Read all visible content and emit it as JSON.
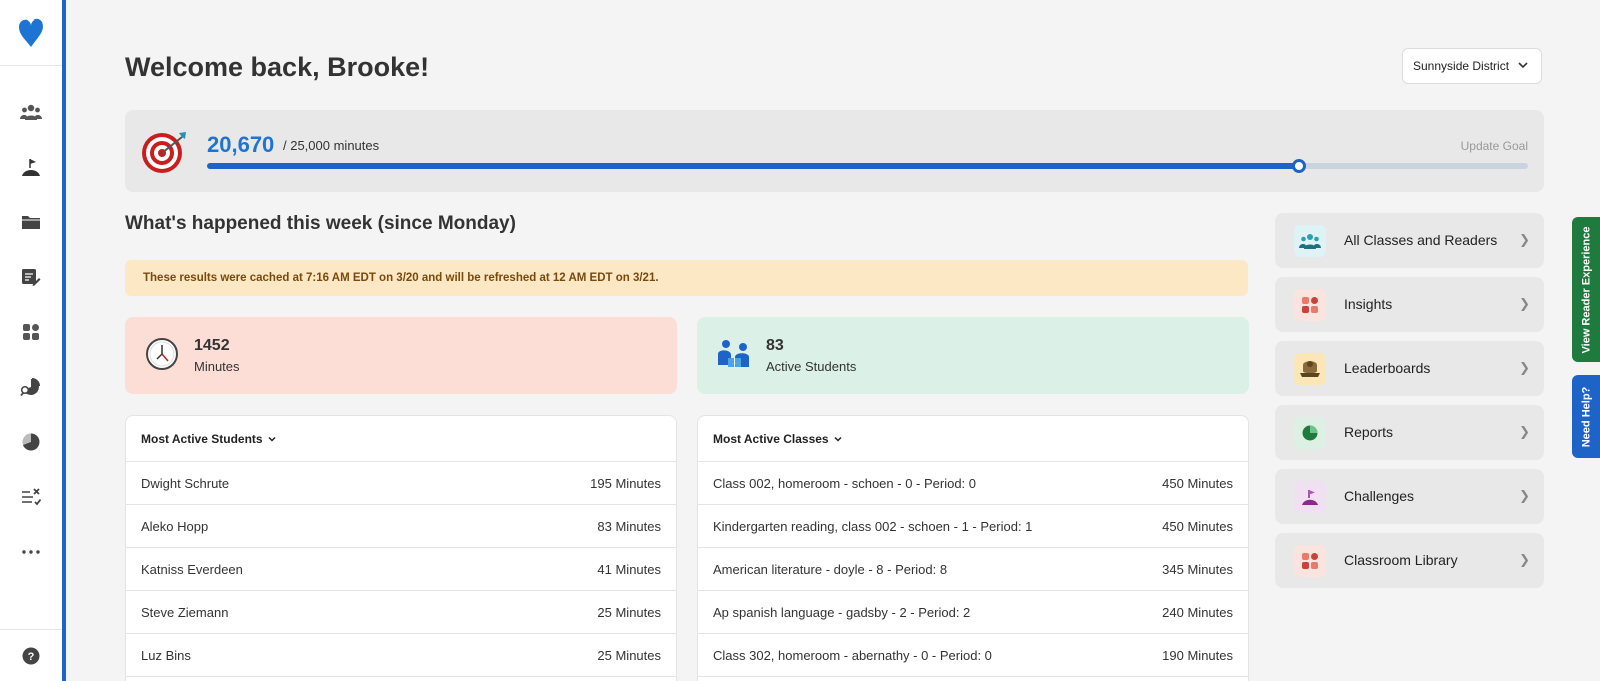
{
  "sidebar": {
    "logo": "heart-logo",
    "items": [
      {
        "name": "classes",
        "icon": "people-icon"
      },
      {
        "name": "challenges",
        "icon": "flag-icon"
      },
      {
        "name": "library",
        "icon": "folder-icon"
      },
      {
        "name": "assignments",
        "icon": "list-edit-icon"
      },
      {
        "name": "insights",
        "icon": "grid-icon"
      },
      {
        "name": "analytics",
        "icon": "pie-search-icon"
      },
      {
        "name": "reports",
        "icon": "pie-icon"
      },
      {
        "name": "tasks",
        "icon": "checklist-icon"
      },
      {
        "name": "more",
        "icon": "more-icon"
      }
    ],
    "help_icon": "help-icon"
  },
  "header": {
    "title": "Welcome back, Brooke!",
    "district": "Sunnyside District"
  },
  "goal": {
    "value": "20,670",
    "total_text": "/ 25,000 minutes",
    "update_label": "Update Goal",
    "progress": 0.8268
  },
  "week": {
    "title": "What's happened this week (since Monday)",
    "cache_note": "These results were cached at 7:16 AM EDT on 3/20 and will be refreshed at 12 AM EDT on 3/21."
  },
  "stats": {
    "minutes": {
      "value": "1452",
      "label": "Minutes"
    },
    "students": {
      "value": "83",
      "label": "Active Students"
    }
  },
  "most_active_students": {
    "label": "Most Active Students",
    "rows": [
      {
        "name": "Dwight Schrute",
        "minutes": "195 Minutes"
      },
      {
        "name": "Aleko Hopp",
        "minutes": "83 Minutes"
      },
      {
        "name": "Katniss Everdeen",
        "minutes": "41 Minutes"
      },
      {
        "name": "Steve Ziemann",
        "minutes": "25 Minutes"
      },
      {
        "name": "Luz Bins",
        "minutes": "25 Minutes"
      }
    ]
  },
  "most_active_classes": {
    "label": "Most Active Classes",
    "rows": [
      {
        "name": "Class 002, homeroom - schoen - 0 - Period: 0",
        "minutes": "450 Minutes"
      },
      {
        "name": "Kindergarten reading, class 002 - schoen - 1 - Period: 1",
        "minutes": "450 Minutes"
      },
      {
        "name": "American literature - doyle - 8 - Period: 8",
        "minutes": "345 Minutes"
      },
      {
        "name": "Ap spanish language - gadsby - 2 - Period: 2",
        "minutes": "240 Minutes"
      },
      {
        "name": "Class 302, homeroom - abernathy - 0 - Period: 0",
        "minutes": "190 Minutes"
      }
    ]
  },
  "side_nav": [
    {
      "label": "All Classes and Readers",
      "icon": "people-icon",
      "color": "#dff3f6"
    },
    {
      "label": "Insights",
      "icon": "grid-icon",
      "color": "#fbe3e0"
    },
    {
      "label": "Leaderboards",
      "icon": "trophy-icon",
      "color": "#fbe6b8"
    },
    {
      "label": "Reports",
      "icon": "pie-icon",
      "color": "#dcf1e4"
    },
    {
      "label": "Challenges",
      "icon": "flag-icon",
      "color": "#f1e0f2"
    },
    {
      "label": "Classroom Library",
      "icon": "grid-icon",
      "color": "#fbe3e0"
    }
  ],
  "tabs": {
    "reader": "View Reader Experience",
    "help": "Need Help?"
  },
  "colors": {
    "accent": "#1e64c8",
    "goal_value": "#1e74d2",
    "reader_tab": "#1f7a3e"
  }
}
